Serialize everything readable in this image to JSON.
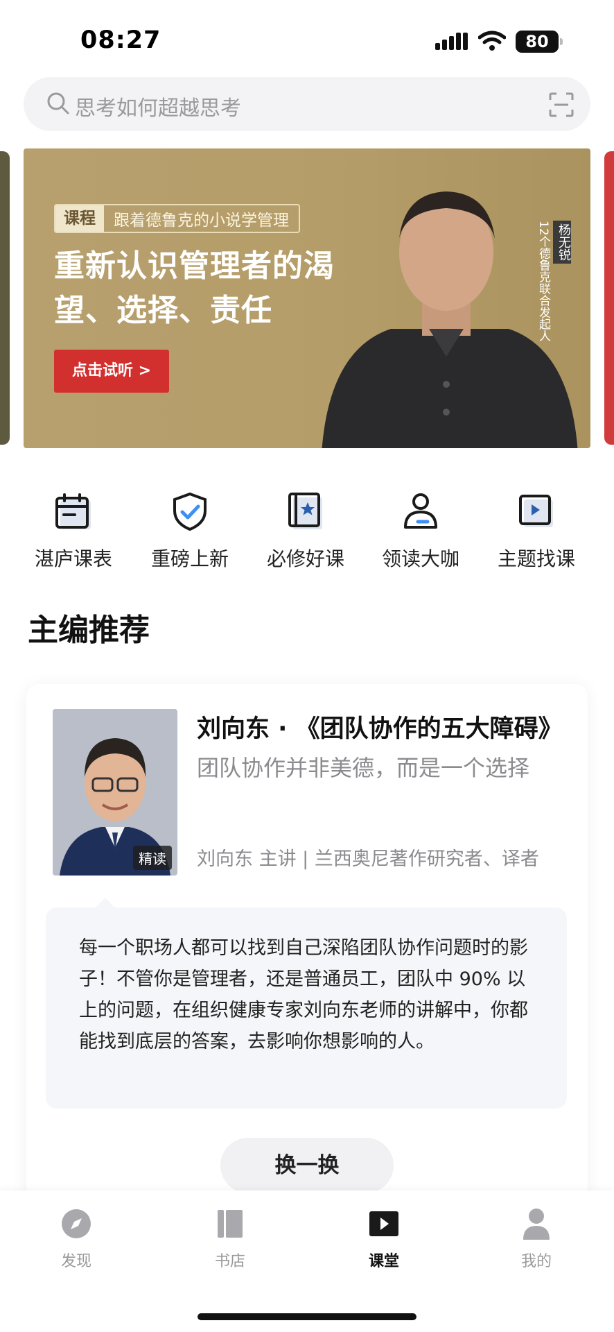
{
  "status_bar": {
    "time": "08:27",
    "battery": "80"
  },
  "search": {
    "placeholder": "思考如何超越思考"
  },
  "banner": {
    "tag": "课程",
    "series": "跟着德鲁克的小说学管理",
    "headline": "重新认识管理者的渴望、选择、责任",
    "cta": "点击试听 >",
    "speaker_name": "杨无锐",
    "speaker_desc": "12个德鲁克联合发起人"
  },
  "quick_nav": [
    {
      "label": "湛庐课表",
      "icon": "calendar-icon"
    },
    {
      "label": "重磅上新",
      "icon": "shield-check-icon"
    },
    {
      "label": "必修好课",
      "icon": "book-star-icon"
    },
    {
      "label": "领读大咖",
      "icon": "person-icon"
    },
    {
      "label": "主题找课",
      "icon": "play-square-icon"
    }
  ],
  "section_title": "主编推荐",
  "recommend": {
    "title": "刘向东 · 《团队协作的五大障碍》",
    "subtitle": "团队协作并非美德，而是一个选择",
    "badge": "精读",
    "author": "刘向东 主讲 | 兰西奥尼著作研究者、译者",
    "description": "每一个职场人都可以找到自己深陷团队协作问题时的影子！不管你是管理者，还是普通员工，团队中 90% 以上的问题，在组织健康专家刘向东老师的讲解中，你都能找到底层的答案，去影响你想影响的人。",
    "swap_label": "换一换"
  },
  "tabs": [
    {
      "label": "发现",
      "icon": "compass-icon",
      "active": false
    },
    {
      "label": "书店",
      "icon": "books-icon",
      "active": false
    },
    {
      "label": "课堂",
      "icon": "play-icon",
      "active": true
    },
    {
      "label": "我的",
      "icon": "user-icon",
      "active": false
    }
  ],
  "colors": {
    "accent_red": "#d2302f",
    "banner_bg": "#b7a06e",
    "text_gray": "#8b8b8f"
  }
}
